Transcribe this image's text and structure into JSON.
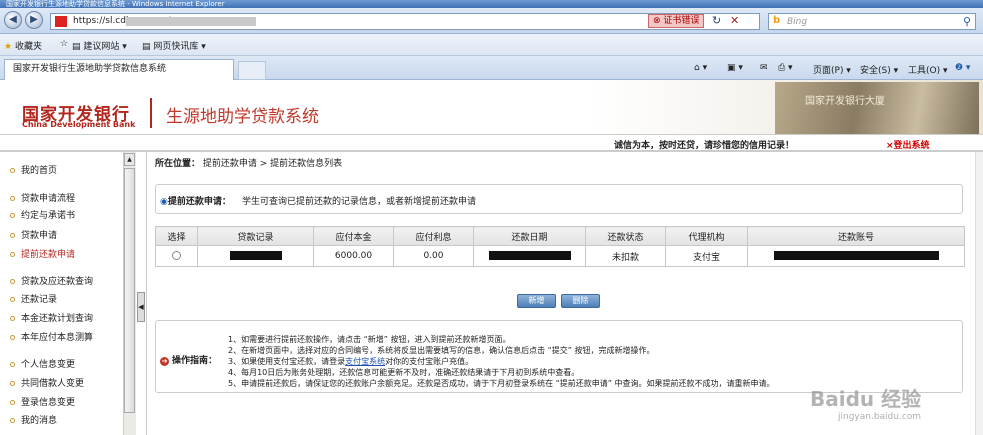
{
  "browser": {
    "title": "国家开发银行生源地助学贷款信息系统 - Windows Internet Explorer",
    "address_url": "https://sl.cdb.com.cn/",
    "cert_warning": "证书错误",
    "search_placeholder": "Bing",
    "favorites_label": "收藏夹",
    "fav_items": [
      "建议网站 ▾",
      "网页快讯库 ▾"
    ],
    "tab_title": "国家开发银行生源地助学贷款信息系统",
    "commands": [
      "页面(P) ▾",
      "安全(S) ▾",
      "工具(O) ▾"
    ]
  },
  "header": {
    "bank_name_cn": "国家开发银行",
    "bank_name_en": "China Development Bank",
    "system_title": "生源地助学贷款系统",
    "building_text": "国家开发银行大厦",
    "slogan": "诚信为本，按时还贷，请珍惜您的信用记录！",
    "logout": "×登出系统"
  },
  "sidebar": {
    "items": [
      {
        "label": "我的首页",
        "active": false
      },
      {
        "label": "贷款申请流程",
        "active": false
      },
      {
        "label": "约定与承诺书",
        "active": false
      },
      {
        "label": "贷款申请",
        "active": false
      },
      {
        "label": "提前还款申请",
        "active": true
      },
      {
        "label": "贷款及应还款查询",
        "active": false
      },
      {
        "label": "还款记录",
        "active": false
      },
      {
        "label": "本金还款计划查询",
        "active": false
      },
      {
        "label": "本年应付本息测算",
        "active": false
      },
      {
        "label": "个人信息变更",
        "active": false
      },
      {
        "label": "共同借款人变更",
        "active": false
      },
      {
        "label": "登录信息变更",
        "active": false
      },
      {
        "label": "我的消息",
        "active": false
      }
    ]
  },
  "breadcrumb": {
    "prefix": "所在位置：",
    "path": "提前还款申请 > 提前还款信息列表"
  },
  "info": {
    "title": "提前还款申请：",
    "text": "学生可查询已提前还款的记录信息，或者新增提前还款申请"
  },
  "table": {
    "headers": [
      "选择",
      "贷款记录",
      "应付本金",
      "应付利息",
      "还款日期",
      "还款状态",
      "代理机构",
      "还款账号"
    ],
    "row": {
      "principal": "6000.00",
      "interest": "0.00",
      "status": "未扣款",
      "agency": "支付宝"
    }
  },
  "buttons": {
    "add": "新增",
    "delete": "删除"
  },
  "guide": {
    "title": "操作指南：",
    "lines": [
      "1、如需要进行提前还款操作，请点击 “新增” 按钮，进入到提前还款新增页面。",
      "2、在新增页面中，选择对应的合同编号，系统将反显出需要填写的信息，确认信息后点击 “提交” 按钮，完成新增操作。",
      "4、每月10日后为账务处理期，还款信息可能更新不及时，准确还款结果请于下月初到系统中查看。",
      "5、申请提前还款后，请保证您的还款账户余额充足。还款是否成功，请于下月初登录系统在 “提前还款申请” 中查询。如果提前还款不成功，请重新申请。"
    ],
    "line3_before": "3、如果使用支付宝还款，请登录",
    "line3_link": "支付宝系统",
    "line3_after": "对你的支付宝账户充值。"
  },
  "watermark": {
    "main": "Baidu 经验",
    "sub": "jingyan.baidu.com"
  }
}
